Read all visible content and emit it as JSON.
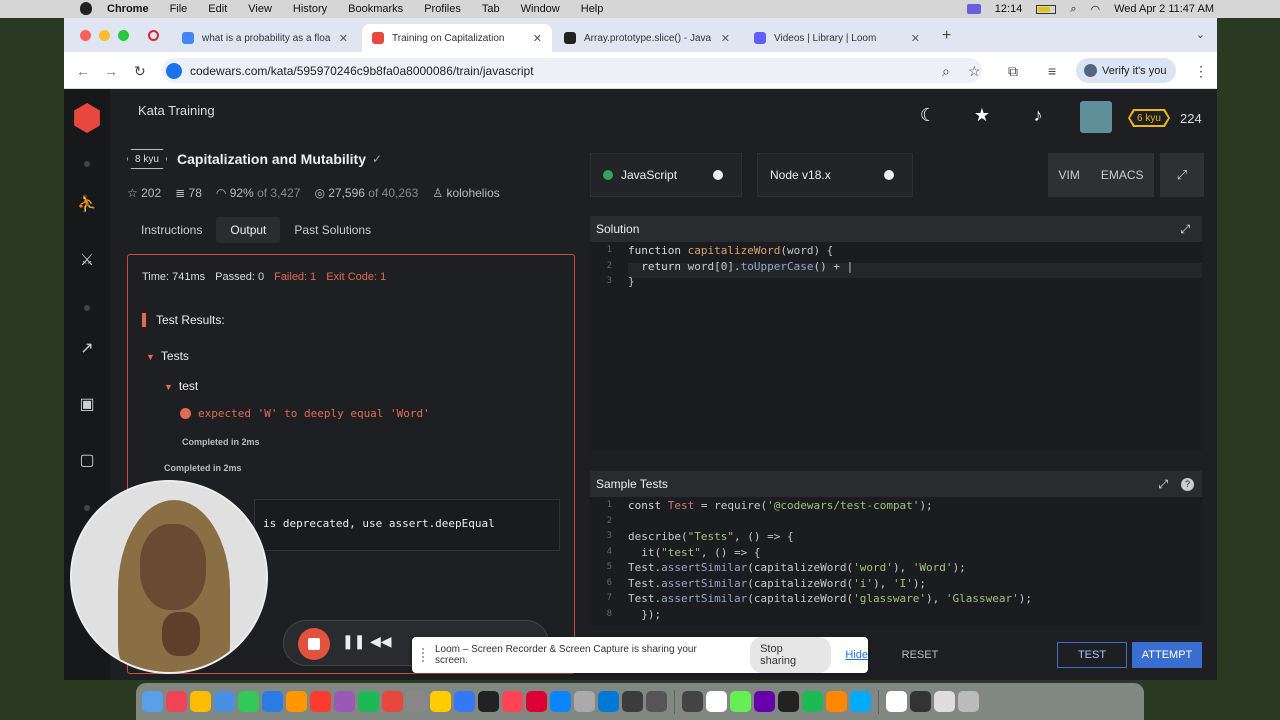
{
  "menubar": {
    "items": [
      "Chrome",
      "File",
      "Edit",
      "View",
      "History",
      "Bookmarks",
      "Profiles",
      "Tab",
      "Window",
      "Help"
    ],
    "recording_time": "12:14",
    "datetime": "Wed Apr 2  11:47 AM"
  },
  "tabs": [
    {
      "title": "what is a probability as a floa",
      "favicon_color": "#4285f4"
    },
    {
      "title": "Training on Capitalization",
      "favicon_color": "#e8473d",
      "active": true
    },
    {
      "title": "Array.prototype.slice() - Java",
      "favicon_color": "#222222"
    },
    {
      "title": "Videos | Library | Loom",
      "favicon_color": "#625df5"
    }
  ],
  "address": {
    "url": "codewars.com/kata/595970246c9b8fa0a8000086/train/javascript",
    "verify_label": "Verify it's you"
  },
  "header": {
    "section_title": "Kata Training",
    "rank_badge": "6 kyu",
    "honor": "224"
  },
  "kata": {
    "rank": "8 kyu",
    "title": "Capitalization and Mutability",
    "check": "✓",
    "stats": {
      "stars": "202",
      "collections": "78",
      "satisfaction": "92%",
      "votes": "of 3,427",
      "completed": "27,596",
      "attempts": "of 40,263",
      "author": "kolohelios"
    }
  },
  "kata_tabs": [
    "Instructions",
    "Output",
    "Past Solutions"
  ],
  "output": {
    "time": "Time: 741ms",
    "passed": "Passed: 0",
    "failed": "Failed: 1",
    "exit_code": "Exit Code: 1",
    "test_results_label": "Test Results:",
    "describe": "Tests",
    "it": "test",
    "error": "expected 'W' to deeply equal 'Word'",
    "completed_inner": "Completed in 2ms",
    "completed_outer": "Completed in 2ms",
    "deprecation": "is deprecated, use assert.deepEqual"
  },
  "toolbar": {
    "language": "JavaScript",
    "version": "Node v18.x",
    "vim": "VIM",
    "emacs": "EMACS"
  },
  "solution": {
    "heading": "Solution",
    "lines": [
      {
        "n": "1",
        "tokens": [
          [
            "kw",
            "function "
          ],
          [
            "fn",
            "capitalizeWord"
          ],
          [
            "pl",
            "(word) {"
          ]
        ]
      },
      {
        "n": "2",
        "tokens": [
          [
            "pl",
            "  "
          ],
          [
            "kw",
            "return "
          ],
          [
            "pl",
            "word[0]."
          ],
          [
            "mt",
            "toUpperCase"
          ],
          [
            "pl",
            "() + |"
          ]
        ]
      },
      {
        "n": "3",
        "tokens": [
          [
            "pl",
            "}"
          ]
        ]
      }
    ]
  },
  "sample_tests": {
    "heading": "Sample Tests",
    "lines": [
      {
        "n": "1",
        "tokens": [
          [
            "kw",
            "const "
          ],
          [
            "obj",
            "Test"
          ],
          [
            "pl",
            " = require("
          ],
          [
            "st",
            "'@codewars/test-compat'"
          ],
          [
            "pl",
            ");"
          ]
        ]
      },
      {
        "n": "2",
        "tokens": []
      },
      {
        "n": "3",
        "tokens": [
          [
            "pl",
            "describe("
          ],
          [
            "st",
            "\"Tests\""
          ],
          [
            "pl",
            ", () => {"
          ]
        ]
      },
      {
        "n": "4",
        "tokens": [
          [
            "pl",
            "  it("
          ],
          [
            "st",
            "\"test\""
          ],
          [
            "pl",
            ", () => {"
          ]
        ]
      },
      {
        "n": "5",
        "tokens": [
          [
            "pl",
            "Test."
          ],
          [
            "mt",
            "assertSimilar"
          ],
          [
            "pl",
            "(capitalizeWord("
          ],
          [
            "st",
            "'word'"
          ],
          [
            "pl",
            "), "
          ],
          [
            "st",
            "'Word'"
          ],
          [
            "pl",
            ");"
          ]
        ]
      },
      {
        "n": "6",
        "tokens": [
          [
            "pl",
            "Test."
          ],
          [
            "mt",
            "assertSimilar"
          ],
          [
            "pl",
            "(capitalizeWord("
          ],
          [
            "st",
            "'i'"
          ],
          [
            "pl",
            "), "
          ],
          [
            "st",
            "'I'"
          ],
          [
            "pl",
            ");"
          ]
        ]
      },
      {
        "n": "7",
        "tokens": [
          [
            "pl",
            "Test."
          ],
          [
            "mt",
            "assertSimilar"
          ],
          [
            "pl",
            "(capitalizeWord("
          ],
          [
            "st",
            "'glassware'"
          ],
          [
            "pl",
            "), "
          ],
          [
            "st",
            "'Glasswear'"
          ],
          [
            "pl",
            ");"
          ]
        ]
      },
      {
        "n": "8",
        "tokens": [
          [
            "pl",
            "  });"
          ]
        ]
      }
    ]
  },
  "actions": {
    "reset": "RESET",
    "test": "TEST",
    "attempt": "ATTEMPT"
  },
  "loom": {
    "share_message": "Loom – Screen Recorder & Screen Capture is sharing your screen.",
    "stop_sharing": "Stop sharing",
    "hide": "Hide"
  },
  "colors": {
    "accent_red": "#e06c51",
    "codewars_red": "#e8473d",
    "button_blue": "#3a6fd1",
    "rank_yellow": "#ecb613"
  }
}
